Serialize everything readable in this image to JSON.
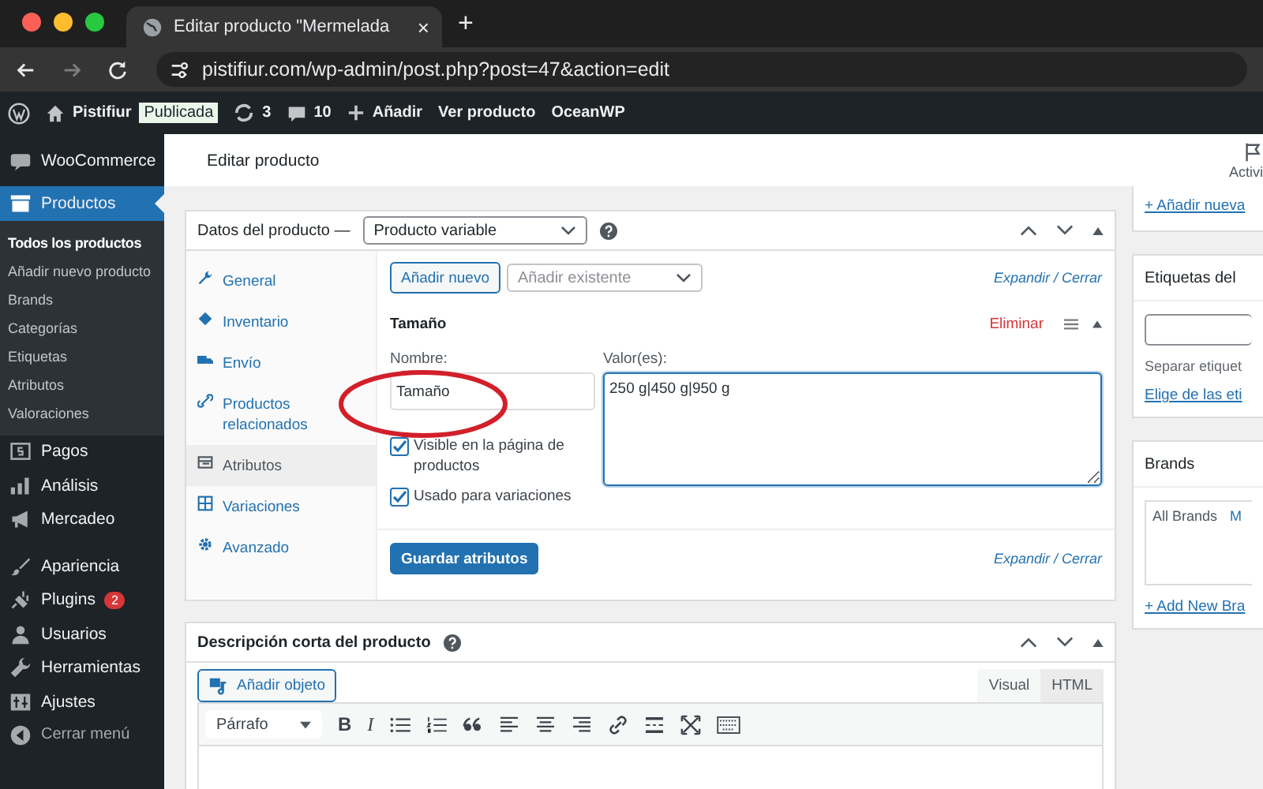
{
  "browser": {
    "tab_title": "Editar producto \"Mermelada",
    "tab_close": "×",
    "new_tab": "+",
    "url": "pistifiur.com/wp-admin/post.php?post=47&action=edit"
  },
  "admin_bar": {
    "site_name": "Pistifiur",
    "status_badge": "Publicada",
    "updates": "3",
    "comments": "10",
    "new_label": "Añadir",
    "view_label": "Ver producto",
    "theme_label": "OceanWP"
  },
  "sidebar": {
    "groups": [
      {
        "items": [
          {
            "label": "WooCommerce",
            "selected": false
          },
          {
            "label": "Productos",
            "selected": true,
            "children": [
              {
                "label": "Todos los productos",
                "selected": true
              },
              {
                "label": "Añadir nuevo producto",
                "selected": false
              },
              {
                "label": "Brands",
                "selected": false
              },
              {
                "label": "Categorías",
                "selected": false
              },
              {
                "label": "Etiquetas",
                "selected": false
              },
              {
                "label": "Atributos",
                "selected": false
              },
              {
                "label": "Valoraciones",
                "selected": false
              }
            ]
          },
          {
            "label": "Pagos",
            "selected": false
          },
          {
            "label": "Análisis",
            "selected": false
          },
          {
            "label": "Mercadeo",
            "selected": false
          }
        ]
      },
      {
        "items": [
          {
            "label": "Apariencia",
            "selected": false
          },
          {
            "label": "Plugins",
            "selected": false,
            "badge": "2"
          },
          {
            "label": "Usuarios",
            "selected": false
          },
          {
            "label": "Herramientas",
            "selected": false
          },
          {
            "label": "Ajustes",
            "selected": false
          }
        ]
      }
    ],
    "collapse_label": "Cerrar menú"
  },
  "page": {
    "title": "Editar producto",
    "activity_label": "Activi"
  },
  "product_data": {
    "title": "Datos del producto —",
    "type_select": "Producto variable",
    "tabs": [
      {
        "label": "General",
        "selected": false
      },
      {
        "label": "Inventario",
        "selected": false
      },
      {
        "label": "Envío",
        "selected": false
      },
      {
        "label": "Productos relacionados",
        "selected": false
      },
      {
        "label": "Atributos",
        "selected": true
      },
      {
        "label": "Variaciones",
        "selected": false
      },
      {
        "label": "Avanzado",
        "selected": false
      }
    ],
    "add_new": "Añadir nuevo",
    "add_existing_placeholder": "Añadir existente",
    "expand_close_top": "Expandir / Cerrar",
    "attribute": {
      "title": "Tamaño",
      "remove": "Eliminar",
      "name_label": "Nombre:",
      "name_value": "Tamaño",
      "values_label": "Valor(es):",
      "values_value": "250 g|450 g|950 g",
      "options": [
        {
          "label": "Visible en la página de productos",
          "checked": true
        },
        {
          "label": "Usado para variaciones",
          "checked": true
        }
      ]
    },
    "save_button": "Guardar atributos",
    "expand_close_bottom": "Expandir / Cerrar"
  },
  "short_description": {
    "title": "Descripción corta del producto",
    "add_media": "Añadir objeto",
    "editor_tabs": [
      {
        "label": "Visual",
        "selected": true
      },
      {
        "label": "HTML",
        "selected": false
      }
    ],
    "format_select": "Párrafo",
    "bold_button": "B",
    "italic_button": "I"
  },
  "right_column": {
    "publish_link": "+ Añadir nueva",
    "tags": {
      "title": "Etiquetas del",
      "hint": "Separar etiquet",
      "choose_link": "Elige de las eti"
    },
    "brands": {
      "title": "Brands",
      "tabs": [
        {
          "label": "All Brands",
          "selected": true
        },
        {
          "label": "M",
          "selected": false
        }
      ],
      "add_link": "+ Add New Bra"
    }
  }
}
